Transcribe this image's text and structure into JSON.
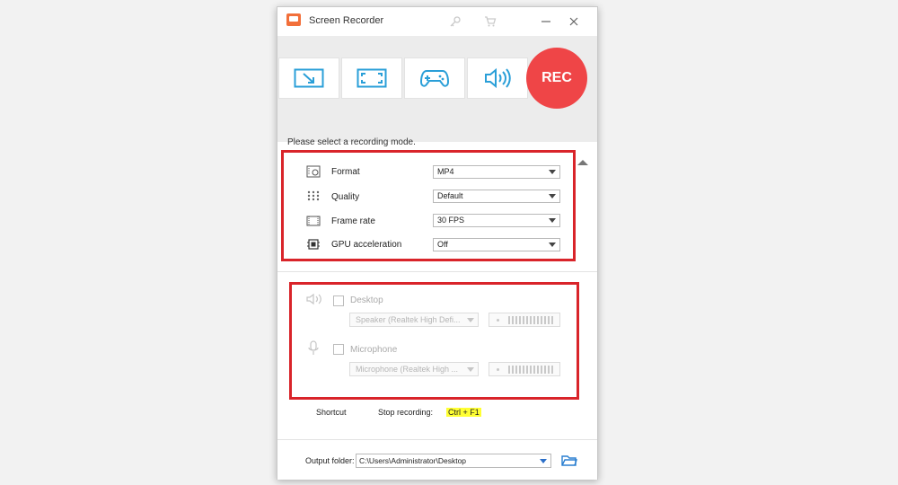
{
  "app": {
    "title": "Screen Recorder",
    "icon": "screen-recorder-app-icon"
  },
  "titlebar": {
    "key_icon": "key-icon",
    "cart_icon": "cart-icon",
    "minimize_icon": "minimize-icon",
    "close_icon": "close-icon"
  },
  "modes": [
    {
      "icon": "region-capture-icon"
    },
    {
      "icon": "fullscreen-capture-icon"
    },
    {
      "icon": "game-capture-icon"
    },
    {
      "icon": "audio-only-icon"
    }
  ],
  "rec_label": "REC",
  "hint": "Please select a recording mode.",
  "settings": {
    "format": {
      "label": "Format",
      "value": "MP4"
    },
    "quality": {
      "label": "Quality",
      "value": "Default"
    },
    "frame_rate": {
      "label": "Frame rate",
      "value": "30 FPS"
    },
    "gpu": {
      "label": "GPU acceleration",
      "value": "Off"
    }
  },
  "audio": {
    "desktop": {
      "label": "Desktop",
      "device": "Speaker (Realtek High Defi..."
    },
    "microphone": {
      "label": "Microphone",
      "device": "Microphone (Realtek High ..."
    }
  },
  "shortcut": {
    "label": "Shortcut",
    "action": "Stop recording:",
    "keys": "Ctrl + F1"
  },
  "output": {
    "label": "Output folder:",
    "path": "C:\\Users\\Administrator\\Desktop"
  },
  "colors": {
    "accent": "#2a9fd8",
    "rec": "#ef4547",
    "highlight_box": "#d9242a",
    "shortcut_highlight": "#ffff33"
  }
}
